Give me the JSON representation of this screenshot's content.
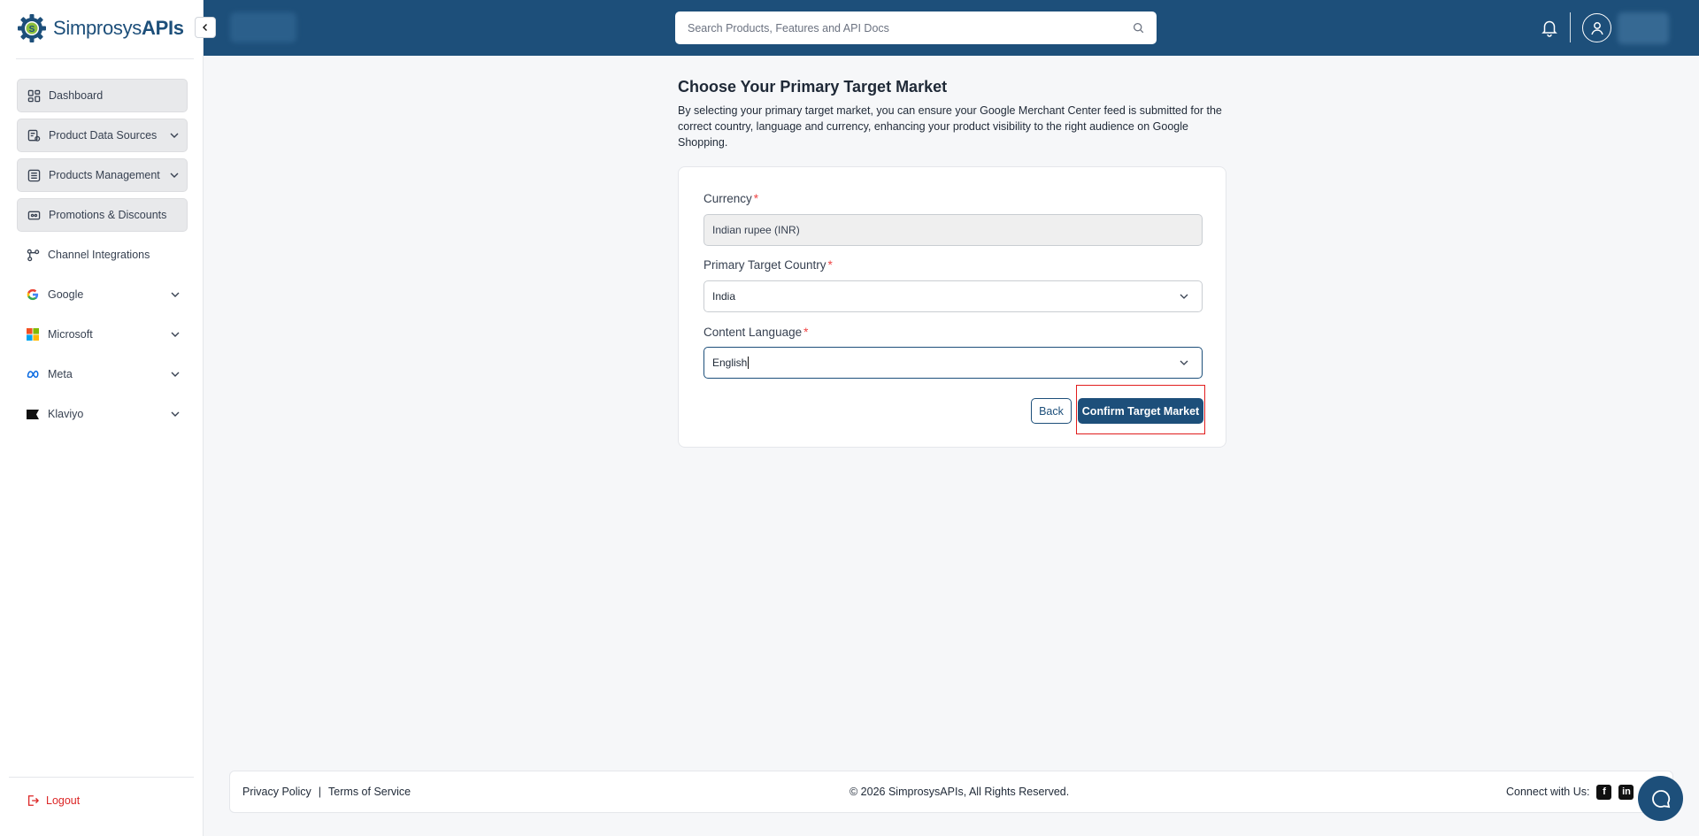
{
  "brand": {
    "name_regular": "Simprosys",
    "name_bold": "APIs"
  },
  "sidebar": {
    "items": [
      {
        "label": "Dashboard",
        "icon": "dashboard-icon"
      },
      {
        "label": "Product Data Sources",
        "icon": "product-data-sources-icon"
      },
      {
        "label": "Products Management",
        "icon": "products-management-icon"
      },
      {
        "label": "Promotions & Discounts",
        "icon": "promotions-icon"
      },
      {
        "label": "Channel Integrations",
        "icon": "channel-integrations-icon"
      },
      {
        "label": "Google",
        "icon": "google-icon"
      },
      {
        "label": "Microsoft",
        "icon": "microsoft-icon"
      },
      {
        "label": "Meta",
        "icon": "meta-icon"
      },
      {
        "label": "Klaviyo",
        "icon": "klaviyo-icon"
      }
    ],
    "logout": "Logout"
  },
  "header": {
    "search_placeholder": "Search Products, Features and API Docs"
  },
  "main": {
    "title": "Choose Your Primary Target Market",
    "description": "By selecting your primary target market, you can ensure your Google Merchant Center feed is submitted for the correct country, language and currency, enhancing your product visibility to the right audience on Google Shopping.",
    "form": {
      "currency_label": "Currency",
      "currency_value": "Indian rupee (INR)",
      "country_label": "Primary Target Country",
      "country_value": "India",
      "language_label": "Content Language",
      "language_value": "English",
      "required_mark": "*"
    },
    "back_label": "Back",
    "confirm_label": "Confirm Target Market"
  },
  "footer": {
    "privacy": "Privacy Policy",
    "separator": "|",
    "terms": "Terms of Service",
    "copyright": "© 2026 SimprosysAPIs, All Rights Reserved.",
    "connect": "Connect with Us:"
  },
  "colors": {
    "brand": "#1d4f7a",
    "accent_red": "#e11d1d",
    "page_bg": "#f6f7f9"
  }
}
